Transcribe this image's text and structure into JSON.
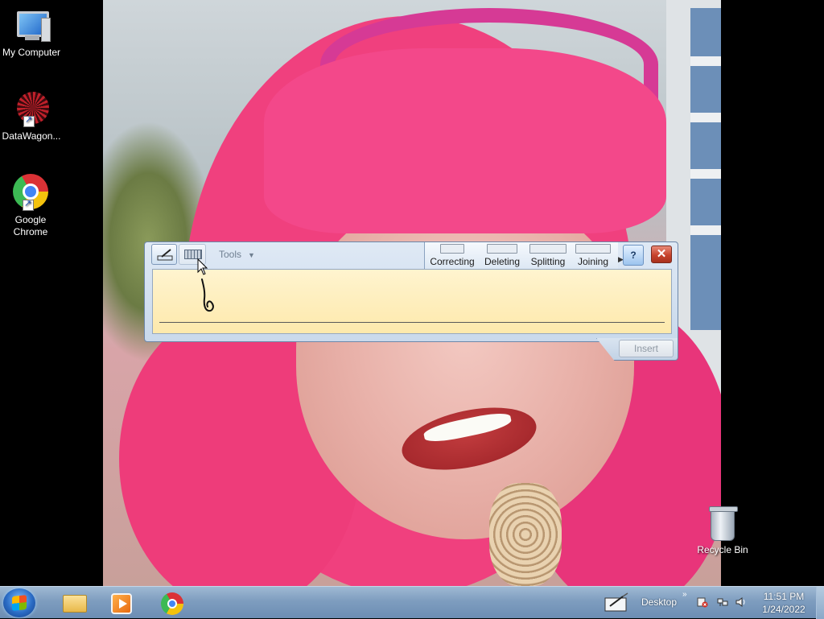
{
  "desktop": {
    "icons": [
      {
        "label": "My Computer",
        "icon": "computer-icon"
      },
      {
        "label": "DataWagon...",
        "icon": "datawagon-icon"
      },
      {
        "label": "Google Chrome",
        "icon": "chrome-icon"
      }
    ],
    "recycle_bin": {
      "label": "Recycle Bin",
      "icon": "recycle-bin-icon"
    }
  },
  "input_panel": {
    "tools_label": "Tools",
    "gestures": [
      "Correcting",
      "Deleting",
      "Splitting",
      "Joining"
    ],
    "help_label": "?",
    "close_label": "✕",
    "insert_label": "Insert"
  },
  "taskbar": {
    "pinned": [
      {
        "name": "Windows Explorer",
        "icon": "folder-icon"
      },
      {
        "name": "Windows Media Player",
        "icon": "media-player-icon"
      },
      {
        "name": "Google Chrome",
        "icon": "chrome-icon"
      }
    ],
    "desktop_toolbar_label": "Desktop",
    "chevron": "»",
    "clock": {
      "time": "11:51 PM",
      "date": "1/24/2022"
    }
  },
  "colors": {
    "write_area": "#fff4cf",
    "close_red": "#c7432c",
    "taskbar": "#7e9dbf"
  }
}
